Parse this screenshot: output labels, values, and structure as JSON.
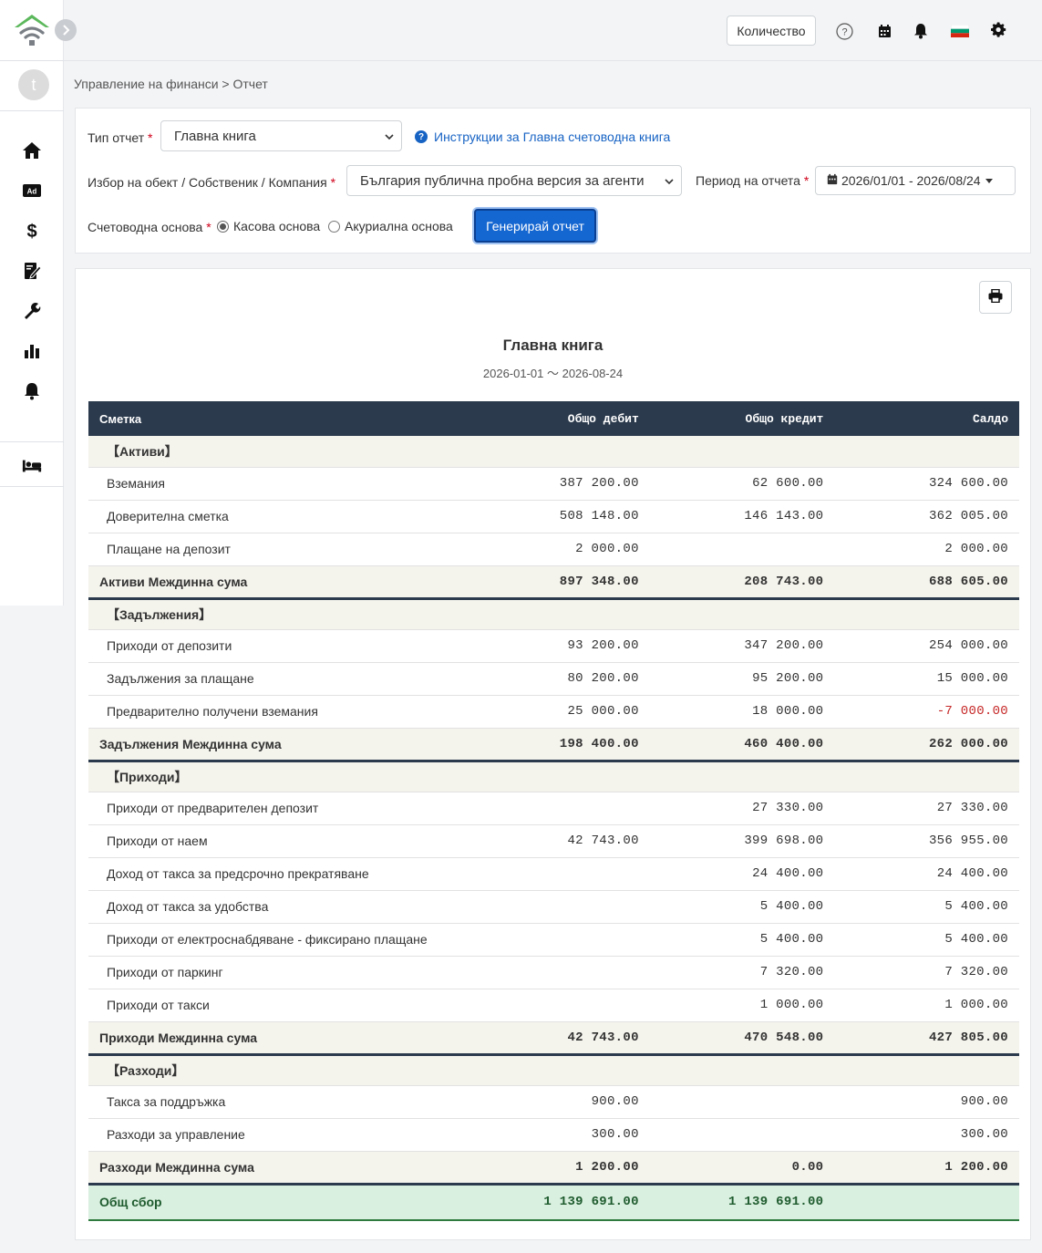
{
  "topbar": {
    "quantity_label": "Количество"
  },
  "sidebar": {
    "avatar_initial": "t"
  },
  "breadcrumb": "Управление на финанси > Отчет",
  "filters": {
    "report_type_label": "Тип отчет",
    "report_type_value": "Главна книга",
    "help_link": "Инструкции за Главна счетоводна книга",
    "object_label": "Избор на обект / Собственик / Компания",
    "object_value": "България публична пробна версия за агенти",
    "period_label": "Период на отчета",
    "period_value": "2026/01/01 - 2026/08/24",
    "basis_label": "Счетоводна основа",
    "basis_cash": "Касова основа",
    "basis_accrual": "Акуриална основа",
    "generate_button": "Генерирай отчет"
  },
  "report": {
    "title": "Главна книга",
    "period": "2026-01-01 〜 2026-08-24",
    "columns": [
      "Сметка",
      "Общо дебит",
      "Общо кредит",
      "Салдо"
    ],
    "assets": {
      "category": "【Активи】",
      "rows": [
        {
          "name": "Вземания",
          "debit": "387 200.00",
          "credit": "62 600.00",
          "balance": "324 600.00"
        },
        {
          "name": "Доверителна сметка",
          "debit": "508 148.00",
          "credit": "146 143.00",
          "balance": "362 005.00"
        },
        {
          "name": "Плащане на депозит",
          "debit": "2 000.00",
          "credit": "",
          "balance": "2 000.00"
        }
      ],
      "subtotal": {
        "name": "Активи Междинна сума",
        "debit": "897 348.00",
        "credit": "208 743.00",
        "balance": "688 605.00"
      }
    },
    "liabilities": {
      "category": "【Задължения】",
      "rows": [
        {
          "name": "Приходи от депозити",
          "debit": "93 200.00",
          "credit": "347 200.00",
          "balance": "254 000.00"
        },
        {
          "name": "Задължения за плащане",
          "debit": "80 200.00",
          "credit": "95 200.00",
          "balance": "15 000.00"
        },
        {
          "name": "Предварително получени вземания",
          "debit": "25 000.00",
          "credit": "18 000.00",
          "balance": "-7 000.00"
        }
      ],
      "subtotal": {
        "name": "Задължения Междинна сума",
        "debit": "198 400.00",
        "credit": "460 400.00",
        "balance": "262 000.00"
      }
    },
    "income": {
      "category": "【Приходи】",
      "rows": [
        {
          "name": "Приходи от предварителен депозит",
          "debit": "",
          "credit": "27 330.00",
          "balance": "27 330.00"
        },
        {
          "name": "Приходи от наем",
          "debit": "42 743.00",
          "credit": "399 698.00",
          "balance": "356 955.00"
        },
        {
          "name": "Доход от такса за предсрочно прекратяване",
          "debit": "",
          "credit": "24 400.00",
          "balance": "24 400.00"
        },
        {
          "name": "Доход от такса за удобства",
          "debit": "",
          "credit": "5 400.00",
          "balance": "5 400.00"
        },
        {
          "name": "Приходи от електроснабдяване - фиксирано плащане",
          "debit": "",
          "credit": "5 400.00",
          "balance": "5 400.00"
        },
        {
          "name": "Приходи от паркинг",
          "debit": "",
          "credit": "7 320.00",
          "balance": "7 320.00"
        },
        {
          "name": "Приходи от такси",
          "debit": "",
          "credit": "1 000.00",
          "balance": "1 000.00"
        }
      ],
      "subtotal": {
        "name": "Приходи Междинна сума",
        "debit": "42 743.00",
        "credit": "470 548.00",
        "balance": "427 805.00"
      }
    },
    "expenses": {
      "category": "【Разходи】",
      "rows": [
        {
          "name": "Такса за поддръжка",
          "debit": "900.00",
          "credit": "",
          "balance": "900.00"
        },
        {
          "name": "Разходи за управление",
          "debit": "300.00",
          "credit": "",
          "balance": "300.00"
        }
      ],
      "subtotal": {
        "name": "Разходи Междинна сума",
        "debit": "1 200.00",
        "credit": "0.00",
        "balance": "1 200.00"
      }
    },
    "total": {
      "name": "Общ сбор",
      "debit": "1 139 691.00",
      "credit": "1 139 691.00",
      "balance": ""
    }
  },
  "icons": [
    "logo-house-wifi-icon",
    "chevron-right-icon",
    "help-circle-icon",
    "calendar-icon",
    "bell-icon",
    "bulgaria-flag-icon",
    "gear-icon",
    "home-icon",
    "ad-icon",
    "dollar-icon",
    "contract-icon",
    "wrench-icon",
    "bar-chart-icon",
    "bell-icon",
    "bed-icon",
    "print-icon"
  ],
  "colors": {
    "header_dark": "#2b3a4d",
    "accent_blue": "#1466d1",
    "negative_red": "#c62828",
    "total_green": "#d9efdf"
  }
}
